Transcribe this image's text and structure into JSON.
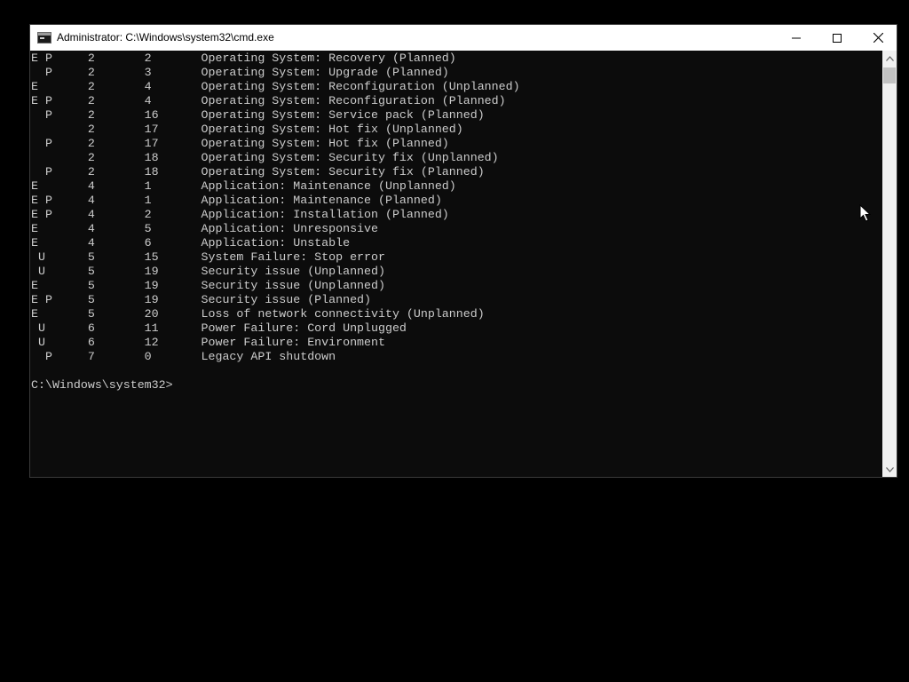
{
  "window": {
    "title": "Administrator: C:\\Windows\\system32\\cmd.exe",
    "icon": "cmd-icon",
    "controls": {
      "minimize": "minimize-icon",
      "maximize": "maximize-icon",
      "close": "close-icon"
    }
  },
  "console": {
    "lines": [
      "E P     2       2       Operating System: Recovery (Planned)",
      "  P     2       3       Operating System: Upgrade (Planned)",
      "E       2       4       Operating System: Reconfiguration (Unplanned)",
      "E P     2       4       Operating System: Reconfiguration (Planned)",
      "  P     2       16      Operating System: Service pack (Planned)",
      "        2       17      Operating System: Hot fix (Unplanned)",
      "  P     2       17      Operating System: Hot fix (Planned)",
      "        2       18      Operating System: Security fix (Unplanned)",
      "  P     2       18      Operating System: Security fix (Planned)",
      "E       4       1       Application: Maintenance (Unplanned)",
      "E P     4       1       Application: Maintenance (Planned)",
      "E P     4       2       Application: Installation (Planned)",
      "E       4       5       Application: Unresponsive",
      "E       4       6       Application: Unstable",
      " U      5       15      System Failure: Stop error",
      " U      5       19      Security issue (Unplanned)",
      "E       5       19      Security issue (Unplanned)",
      "E P     5       19      Security issue (Planned)",
      "E       5       20      Loss of network connectivity (Unplanned)",
      " U      6       11      Power Failure: Cord Unplugged",
      " U      6       12      Power Failure: Environment",
      "  P     7       0       Legacy API shutdown",
      "",
      "C:\\Windows\\system32>"
    ]
  },
  "colors": {
    "console_background": "#0c0c0c",
    "console_text": "#cccccc",
    "titlebar_background": "#ffffff",
    "desktop_background": "#000000"
  }
}
